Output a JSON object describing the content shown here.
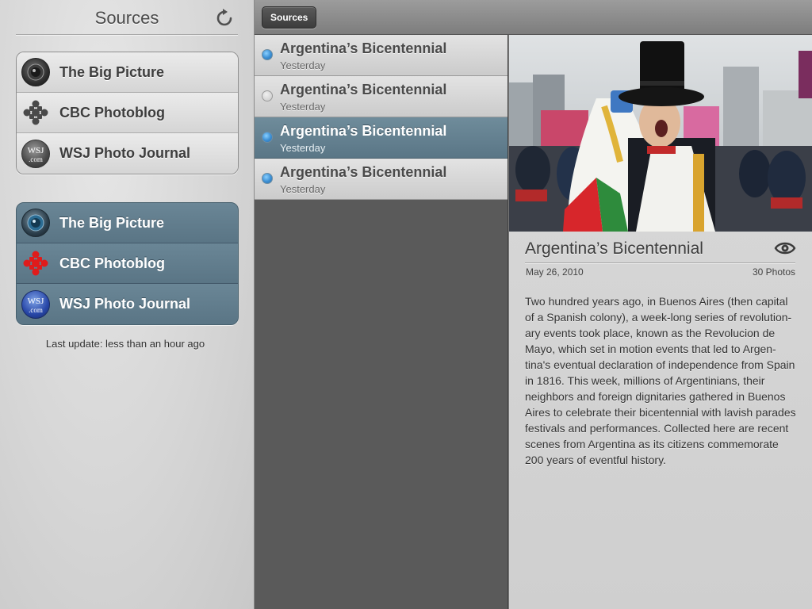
{
  "sidebar": {
    "title": "Sources",
    "refresh_icon": "refresh-icon",
    "groups": [
      {
        "style": "light",
        "items": [
          {
            "label": "The Big Picture",
            "icon": "big-picture-icon"
          },
          {
            "label": "CBC Photoblog",
            "icon": "cbc-gem-icon"
          },
          {
            "label": "WSJ Photo Journal",
            "icon": "wsj-icon"
          }
        ]
      },
      {
        "style": "dark",
        "items": [
          {
            "label": "The Big Picture",
            "icon": "big-picture-icon"
          },
          {
            "label": "CBC Photoblog",
            "icon": "cbc-gem-icon"
          },
          {
            "label": "WSJ Photo Journal",
            "icon": "wsj-icon"
          }
        ]
      }
    ],
    "last_update": "Last update: less than an hour ago"
  },
  "topbar": {
    "sources_button": "Sources"
  },
  "list": {
    "items": [
      {
        "title": "Argentina’s Bicentennial",
        "date": "Yesterday",
        "unread": true,
        "selected": false
      },
      {
        "title": "Argentina’s Bicentennial",
        "date": "Yesterday",
        "unread": false,
        "selected": false
      },
      {
        "title": "Argentina’s Bicentennial",
        "date": "Yesterday",
        "unread": true,
        "selected": true
      },
      {
        "title": "Argentina’s Bicentennial",
        "date": "Yesterday",
        "unread": true,
        "selected": false
      }
    ]
  },
  "detail": {
    "title": "Argentina’s Bicentennial",
    "date": "May 26, 2010",
    "photo_count": "30 Photos",
    "view_icon": "eye-icon",
    "body": "Two hundred years ago, in Buenos Aires (then capital of a Spanish colony), a week-long series of revolution-ary events took place, known as the Revolucion de Mayo, which set in motion events that led to Argen-tina's eventual declaration of independence from Spain in 1816. This week, millions of Argentinians, their neighbors and foreign dignitaries gathered in Buenos Aires to celebrate their bicentennial with lavish parades festivals and performances. Collected here are recent scenes from Argentina as its citizens commemorate 200 years of eventful history."
  },
  "colors": {
    "selected_row": "#5e7a8a",
    "unread_dot": "#3b8ed3",
    "cbc_red": "#e01b1b"
  }
}
